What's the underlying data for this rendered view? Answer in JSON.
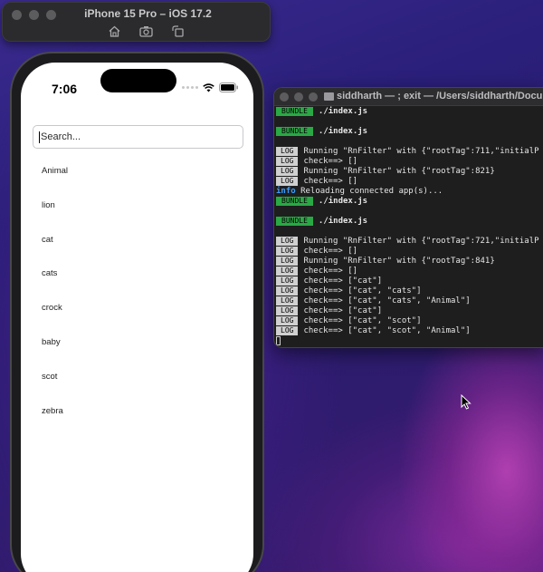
{
  "simulator": {
    "title": "iPhone 15 Pro – iOS 17.2",
    "tools": [
      "home-icon",
      "screenshot-icon",
      "rotate-icon"
    ]
  },
  "phone": {
    "time": "7:06",
    "search": {
      "value": "",
      "placeholder": "Search..."
    },
    "items": [
      "Animal",
      "lion",
      "cat",
      "cats",
      "crock",
      "baby",
      "scot",
      "zebra"
    ]
  },
  "terminal": {
    "title": "siddharth — ; exit — /Users/siddharth/Documen",
    "lines": [
      {
        "tag": "BUNDLE",
        "text": "./index.js"
      },
      {
        "tag": "",
        "text": ""
      },
      {
        "tag": "BUNDLE",
        "text": "./index.js"
      },
      {
        "tag": "",
        "text": ""
      },
      {
        "tag": "LOG",
        "text": "Running \"RnFilter\" with {\"rootTag\":711,\"initialP"
      },
      {
        "tag": "LOG",
        "text": "check==> []"
      },
      {
        "tag": "LOG",
        "text": "Running \"RnFilter\" with {\"rootTag\":821}"
      },
      {
        "tag": "LOG",
        "text": "check==> []"
      },
      {
        "tag": "info",
        "text": "Reloading connected app(s)..."
      },
      {
        "tag": "BUNDLE",
        "text": "./index.js"
      },
      {
        "tag": "",
        "text": ""
      },
      {
        "tag": "BUNDLE",
        "text": "./index.js"
      },
      {
        "tag": "",
        "text": ""
      },
      {
        "tag": "LOG",
        "text": "Running \"RnFilter\" with {\"rootTag\":721,\"initialP"
      },
      {
        "tag": "LOG",
        "text": "check==> []"
      },
      {
        "tag": "LOG",
        "text": "Running \"RnFilter\" with {\"rootTag\":841}"
      },
      {
        "tag": "LOG",
        "text": "check==> []"
      },
      {
        "tag": "LOG",
        "text": "check==> [\"cat\"]"
      },
      {
        "tag": "LOG",
        "text": "check==> [\"cat\", \"cats\"]"
      },
      {
        "tag": "LOG",
        "text": "check==> [\"cat\", \"cats\", \"Animal\"]"
      },
      {
        "tag": "LOG",
        "text": "check==> [\"cat\"]"
      },
      {
        "tag": "LOG",
        "text": "check==> [\"cat\", \"scot\"]"
      },
      {
        "tag": "LOG",
        "text": "check==> [\"cat\", \"scot\", \"Animal\"]"
      }
    ]
  },
  "colors": {
    "bundle_tag": "#2aa845",
    "log_tag": "#d0d0d0",
    "info_text": "#3b9dff",
    "terminal_bg": "#1e1e1e"
  }
}
